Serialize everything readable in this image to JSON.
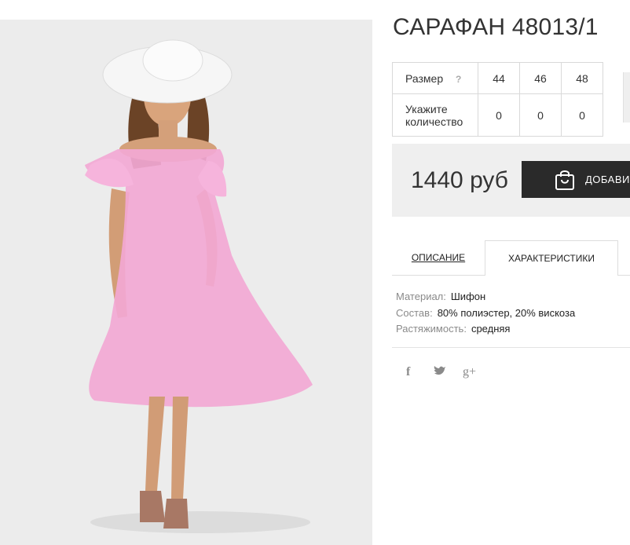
{
  "product": {
    "title": "САРАФАН 48013/1",
    "sizes_label": "Размер",
    "help_symbol": "?",
    "sizes": [
      "44",
      "46",
      "48"
    ],
    "quantity_label": "Укажите количество",
    "quantities": [
      "0",
      "0",
      "0"
    ],
    "price": "1440 руб",
    "add_button_label": "ДОБАВИТ"
  },
  "tabs": [
    {
      "label": "ОПИСАНИЕ",
      "active": false
    },
    {
      "label": "ХАРАКТЕРИСТИКИ",
      "active": true
    }
  ],
  "properties": [
    {
      "key": "Материал:",
      "value": "Шифон"
    },
    {
      "key": "Состав:",
      "value": "80% полиэстер, 20% вискоза"
    },
    {
      "key": "Растяжимость:",
      "value": "средняя"
    }
  ],
  "social": [
    "facebook-icon",
    "twitter-icon",
    "google-plus-icon"
  ],
  "social_glyphs": {
    "facebook": "f",
    "twitter": "🐦",
    "google_plus": "g+"
  },
  "colors": {
    "dress": "#f4a6d2",
    "button": "#2a2a2a",
    "panel": "#efefef"
  }
}
